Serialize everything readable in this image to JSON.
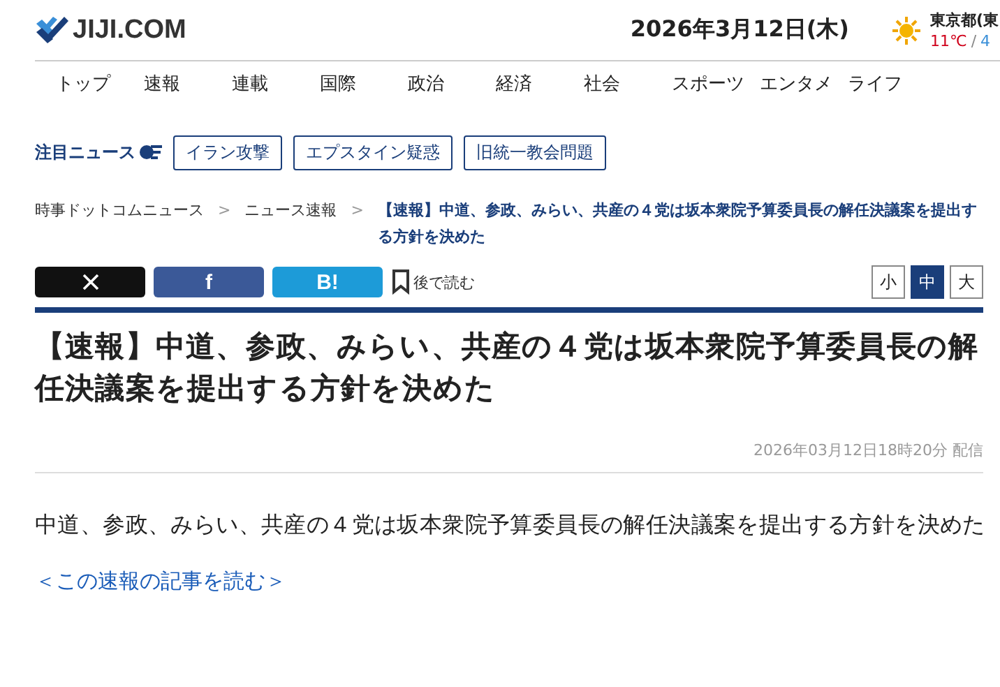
{
  "header": {
    "logo": "JIJI.COM",
    "date": "2026年3月12日(木)",
    "weather": {
      "place": "東京都(東",
      "high": "11℃",
      "separator": "/",
      "low": "4"
    }
  },
  "nav": [
    {
      "label": "トップ"
    },
    {
      "label": "速報"
    },
    {
      "label": "連載"
    },
    {
      "label": "国際"
    },
    {
      "label": "政治"
    },
    {
      "label": "経済"
    },
    {
      "label": "社会"
    },
    {
      "label": "スポーツ"
    },
    {
      "label": "エンタメ"
    },
    {
      "label": "ライフ"
    }
  ],
  "featured": {
    "label": "注目ニュース",
    "tags": [
      "イラン攻撃",
      "エプスタイン疑惑",
      "旧統一教会問題"
    ]
  },
  "breadcrumb_separator": ">",
  "breadcrumb": [
    {
      "label": "時事ドットコムニュース",
      "current": false
    },
    {
      "label": "ニュース速報",
      "current": false
    },
    {
      "label": "【速報】中道、参政、みらい、共産の４党は坂本衆院予算委員長の解任決議案を提出する方針を決めた",
      "current": true
    }
  ],
  "share": [
    {
      "kind": "x"
    },
    {
      "kind": "facebook",
      "label": "f"
    },
    {
      "kind": "hatena",
      "label": "B!"
    }
  ],
  "read_later": "後で読む",
  "font_sizes": [
    {
      "label": "小",
      "selected": false
    },
    {
      "label": "中",
      "selected": true
    },
    {
      "label": "大",
      "selected": false
    }
  ],
  "article": {
    "title": "【速報】中道、参政、みらい、共産の４党は坂本衆院予算委員長の解任決議案を提出する方針を決めた",
    "published": "2026年03月12日18時20分",
    "published_suffix": "配信",
    "body": "中道、参政、みらい、共産の４党は坂本衆院予算委員長の解任決議案を提出する方針を決めた",
    "link": "＜この速報の記事を読む＞"
  }
}
